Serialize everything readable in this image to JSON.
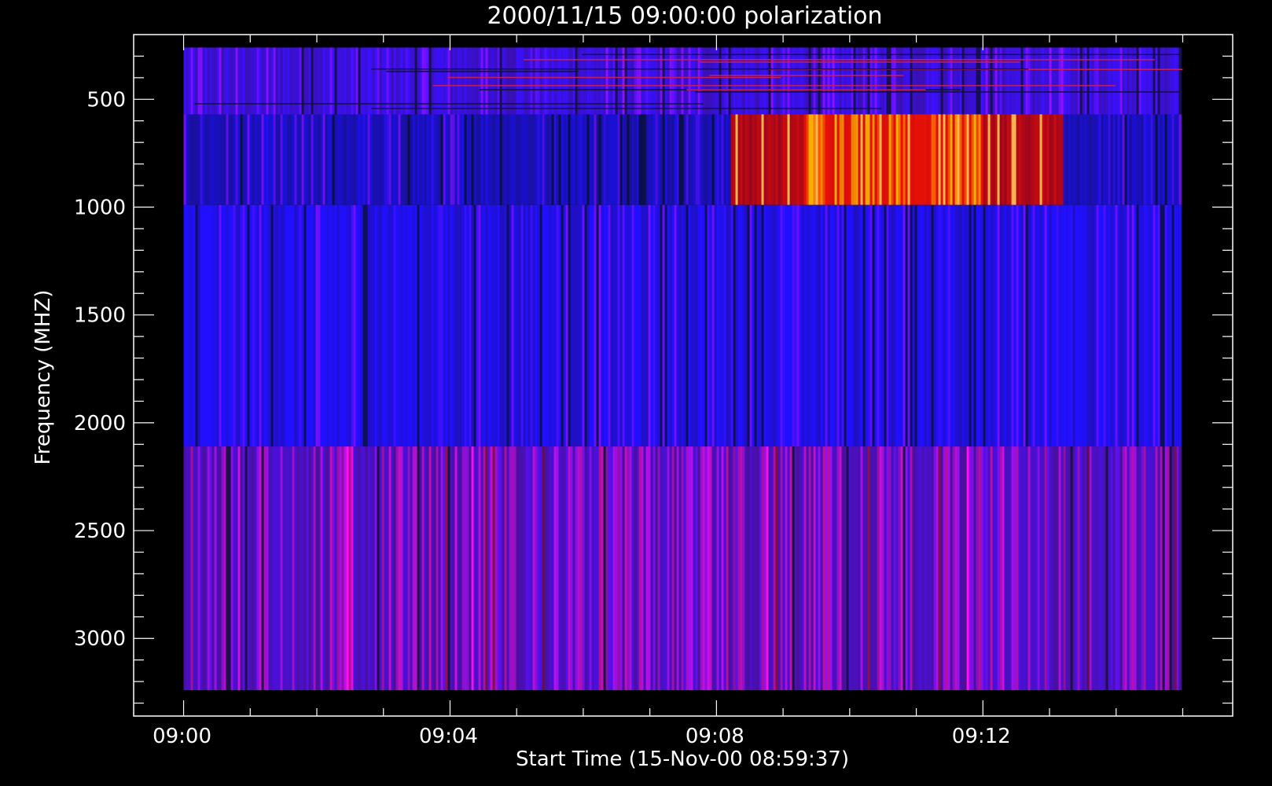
{
  "chart_data": {
    "type": "heatmap",
    "title": "2000/11/15 09:00:00 polarization",
    "xlabel": "Start Time (15-Nov-00 08:59:37)",
    "ylabel": "Frequency (MHZ)",
    "x_tick_labels": [
      "09:00",
      "09:04",
      "09:08",
      "09:12"
    ],
    "x_tick_values_min": [
      0,
      4,
      8,
      12
    ],
    "x_range_min": [
      -0.75,
      15.75
    ],
    "data_x_range_min": [
      0,
      15
    ],
    "y_tick_labels": [
      "500",
      "1000",
      "1500",
      "2000",
      "2500",
      "3000"
    ],
    "y_tick_values": [
      500,
      1000,
      1500,
      2000,
      2500,
      3000
    ],
    "y_range_mhz": [
      200,
      3360
    ],
    "y_reversed": true,
    "frequency_bands": [
      {
        "name": "band-260-570",
        "range_mhz": [
          260,
          570
        ],
        "base_color": "#3a10e0",
        "note": "noisy with horizontal streaks"
      },
      {
        "name": "band-570-990",
        "range_mhz": [
          570,
          990
        ],
        "base_color": "#1a10c0",
        "burst_min": [
          8.2,
          13.2
        ],
        "burst_peak_min": [
          9.3,
          12.0
        ]
      },
      {
        "name": "band-990-2110",
        "range_mhz": [
          990,
          2110
        ],
        "base_color": "#2010f0"
      },
      {
        "name": "band-2110-3240",
        "range_mhz": [
          2110,
          3240
        ],
        "base_color": "#4a10c0"
      }
    ],
    "colors": {
      "background": "#000000",
      "axes": "#ffffff",
      "low": "#0000ff",
      "high": "#ff3000"
    }
  }
}
